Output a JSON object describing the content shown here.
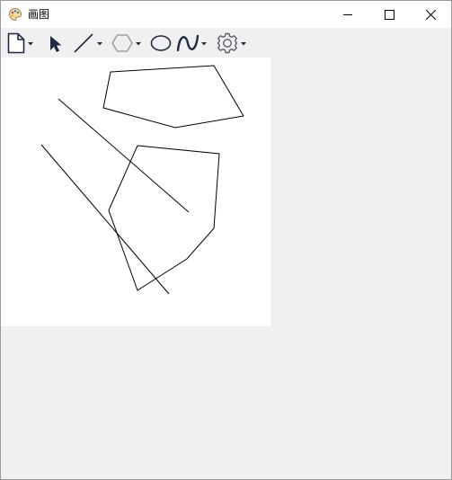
{
  "window": {
    "title": "画图",
    "app_icon": "palette-icon",
    "controls": [
      "minimize-icon",
      "maximize-icon",
      "close-icon"
    ]
  },
  "toolbar": {
    "tools": [
      {
        "name": "new-file",
        "icon": "document-icon",
        "has_dropdown": true
      },
      {
        "name": "select",
        "icon": "cursor-arrow-icon",
        "has_dropdown": false
      },
      {
        "name": "line",
        "icon": "line-icon",
        "has_dropdown": true
      },
      {
        "name": "polygon",
        "icon": "hexagon-icon",
        "has_dropdown": true
      },
      {
        "name": "ellipse",
        "icon": "ellipse-icon",
        "has_dropdown": false
      },
      {
        "name": "curve",
        "icon": "curve-icon",
        "has_dropdown": true
      },
      {
        "name": "settings",
        "icon": "gear-icon",
        "has_dropdown": true
      }
    ]
  },
  "canvas": {
    "background": "#ffffff",
    "stroke_color": "#000000"
  },
  "colors": {
    "titlebar": "#ffffff",
    "window_bg": "#f0f0f0",
    "border": "#9a9a9a"
  }
}
